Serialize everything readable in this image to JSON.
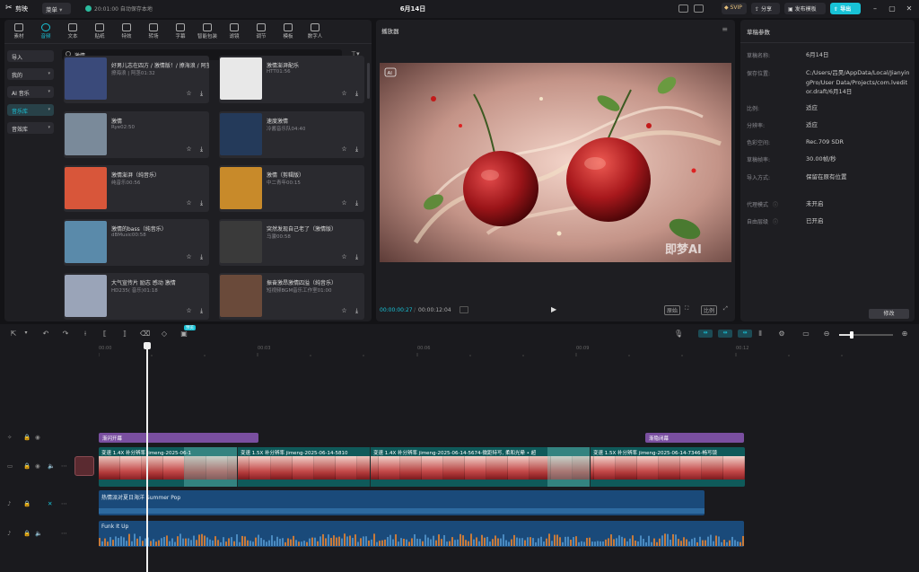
{
  "titlebar": {
    "app_name": "剪映",
    "menu_label": "菜单",
    "save_status": "20:01:00 自动保存本地",
    "project_title": "6月14日",
    "svip_label": "SVIP",
    "share_label": "分享",
    "publish_template_label": "发布模板",
    "export_label": "导出"
  },
  "toolbar_tabs": [
    {
      "label": "素材",
      "icon": "media-icon"
    },
    {
      "label": "音频",
      "icon": "audio-icon",
      "active": true
    },
    {
      "label": "文本",
      "icon": "text-icon"
    },
    {
      "label": "贴纸",
      "icon": "sticker-icon"
    },
    {
      "label": "特效",
      "icon": "effects-icon"
    },
    {
      "label": "转场",
      "icon": "transition-icon"
    },
    {
      "label": "字幕",
      "icon": "subtitle-icon"
    },
    {
      "label": "智能包装",
      "icon": "smart-pack-icon"
    },
    {
      "label": "滤镜",
      "icon": "filter-icon"
    },
    {
      "label": "调节",
      "icon": "adjust-icon"
    },
    {
      "label": "模板",
      "icon": "template-icon"
    },
    {
      "label": "数字人",
      "icon": "digital-human-icon"
    }
  ],
  "sidebar": {
    "items": [
      {
        "label": "导入"
      },
      {
        "label": "我的"
      },
      {
        "label": "AI 音乐"
      },
      {
        "label": "音乐库",
        "active": true
      },
      {
        "label": "音效库"
      }
    ]
  },
  "search": {
    "value": "激情"
  },
  "music_cards": [
    {
      "title": "好男儿志在四方 / 激情版！/ 撩海浪 / 阿茎",
      "sub": "撩海浪 | 阿茎01:32",
      "theme": "#3a4a7a"
    },
    {
      "title": "激情澎湃配乐",
      "sub": "HTT01:56",
      "theme": "#e8e8e8"
    },
    {
      "title": "激情",
      "sub": "Rye02:50",
      "theme": "#7a8a9a"
    },
    {
      "title": "速度激情",
      "sub": "冷酱音乐队04:40",
      "theme": "#243a5a"
    },
    {
      "title": "激情澎湃（纯音乐）",
      "sub": "纯音乐00:56",
      "theme": "#d8563a"
    },
    {
      "title": "激情（剪辑版）",
      "sub": "中二青年00:15",
      "theme": "#c88a2a"
    },
    {
      "title": "激情的bass（纯音乐）",
      "sub": "dBMusic00:58",
      "theme": "#5a8aaa"
    },
    {
      "title": "突然发现自己老了（激情版）",
      "sub": "马骏00:58",
      "theme": "#3a3a3a"
    },
    {
      "title": "大气宣传片 励志 感动 激情",
      "sub": "HD235( 音乐)01:18",
      "theme": "#9aa4b8"
    },
    {
      "title": "振奋激昂激情四溢（纯音乐）",
      "sub": "短视频BGM音乐工作室01:00",
      "theme": "#6a4a3a"
    }
  ],
  "player": {
    "title": "播放器",
    "current_time": "00:00:00:27",
    "total_time": "00:00:12:04",
    "ai_badge": "AI",
    "watermark": "即梦AI",
    "ratio_label": "比例",
    "original_label": "原始"
  },
  "properties": {
    "title": "草稿参数",
    "rows": [
      {
        "key": "草稿名称:",
        "value": "6月14日"
      },
      {
        "key": "保存位置:",
        "value": "C:/Users/吕昊/AppData/Local/JianyingPro/User Data/Projects/com.lveditor.draft/6月14日"
      },
      {
        "key": "比例:",
        "value": "适应"
      },
      {
        "key": "分辨率:",
        "value": "适应"
      },
      {
        "key": "色彩空间:",
        "value": "Rec.709 SDR"
      },
      {
        "key": "草稿帧率:",
        "value": "30.00帧/秒"
      },
      {
        "key": "导入方式:",
        "value": "保留在原有位置"
      },
      {
        "key": "代理模式",
        "value": "未开启"
      },
      {
        "key": "自由层级",
        "value": "已开启"
      }
    ],
    "modify_label": "修改"
  },
  "timeline": {
    "ruler": [
      "00:00",
      "00:03",
      "00:06",
      "00:09",
      "00:12"
    ],
    "effect_track": [
      {
        "label": "渐闪开幕"
      },
      {
        "label": "渐隐闭幕"
      }
    ],
    "video_clips": [
      {
        "label": "变速 1.4X  补分辨率  jimeng-2025-06-1"
      },
      {
        "label": "变速 1.5X  补分辨率  jimeng-2025-06-14-5810"
      },
      {
        "label": "变速 1.4X  补分辨率  jimeng-2025-06-14-5674-微距特写, 柔和光晕 • 超"
      },
      {
        "label": "变速 1.5X  补分辨率  jimeng-2025-06-14-7346-畅写镜"
      }
    ],
    "audio_tracks": [
      {
        "label": "热情派对夏日海洋 Summer Pop"
      },
      {
        "label": "Funk It Up"
      }
    ],
    "snap_badge": "预览"
  }
}
